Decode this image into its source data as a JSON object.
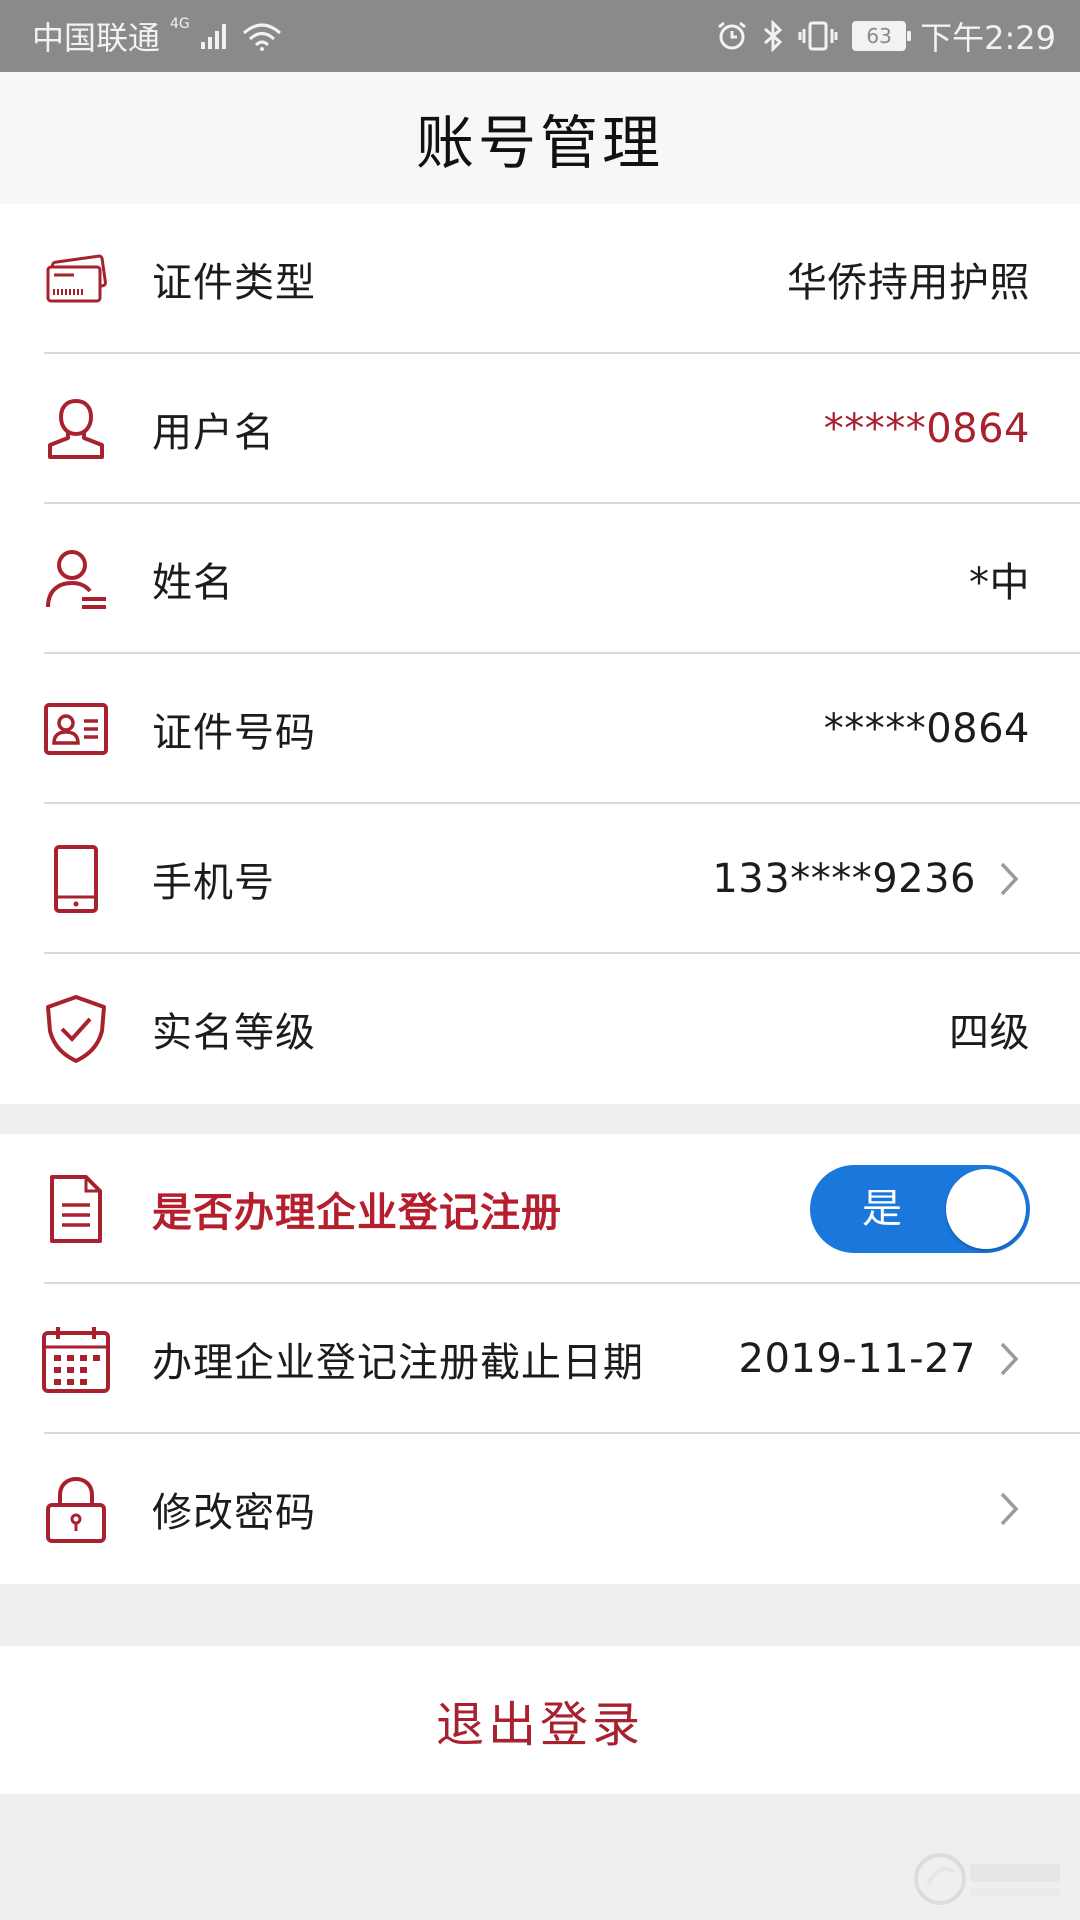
{
  "status_bar": {
    "carrier": "中国联通",
    "network": "4G",
    "battery": "63",
    "time": "下午2:29"
  },
  "header": {
    "title": "账号管理"
  },
  "info": {
    "rows": [
      {
        "label": "证件类型",
        "value": "华侨持用护照"
      },
      {
        "label": "用户名",
        "value": "*****0864"
      },
      {
        "label": "姓名",
        "value": "*中"
      },
      {
        "label": "证件号码",
        "value": "*****0864"
      },
      {
        "label": "手机号",
        "value": "133****9236"
      },
      {
        "label": "实名等级",
        "value": "四级"
      }
    ]
  },
  "business": {
    "register_label": "是否办理企业登记注册",
    "toggle_label": "是",
    "deadline_label": "办理企业登记注册截止日期",
    "deadline_value": "2019-11-27",
    "password_label": "修改密码"
  },
  "logout_label": "退出登录",
  "colors": {
    "accent_red": "#a8212e",
    "toggle_blue": "#1a78dd",
    "background": "#efeff1"
  },
  "icons": [
    "signal-icon",
    "wifi-icon",
    "alarm-icon",
    "bluetooth-icon",
    "vibrate-icon",
    "card-icon",
    "user-icon",
    "person-list-icon",
    "id-card-icon",
    "phone-icon",
    "shield-check-icon",
    "document-icon",
    "calendar-icon",
    "lock-icon",
    "chevron-right-icon"
  ]
}
